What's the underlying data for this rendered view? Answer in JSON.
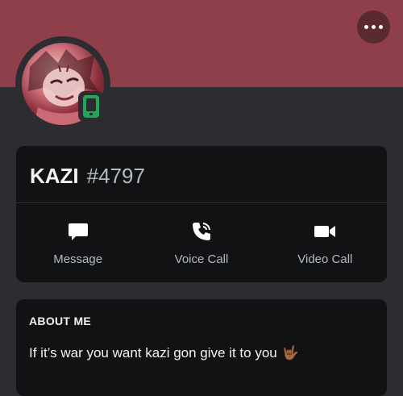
{
  "profile": {
    "username": "KAZI",
    "discriminator": "#4797",
    "banner_color": "#8f3f4a",
    "status": "mobile-online",
    "status_color": "#23a55a"
  },
  "actions": [
    {
      "label": "Message",
      "icon": "chat-bubble-icon"
    },
    {
      "label": "Voice Call",
      "icon": "phone-call-icon"
    },
    {
      "label": "Video Call",
      "icon": "video-camera-icon"
    }
  ],
  "about": {
    "title": "ABOUT ME",
    "text": "If it’s war you want kazi gon give it to you",
    "emoji": "🤟🏾"
  }
}
